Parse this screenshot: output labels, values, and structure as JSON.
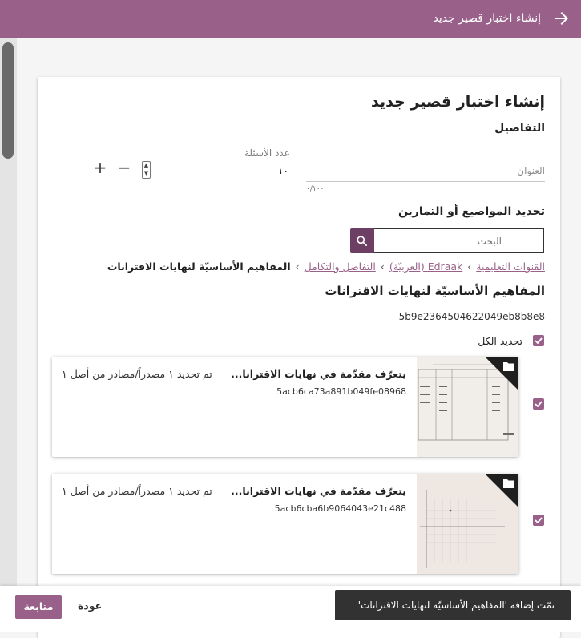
{
  "appbar": {
    "title": "إنشاء اختبار قصير جديد",
    "back_icon": "arrow-right-icon",
    "color": "#996189"
  },
  "form": {
    "heading": "إنشاء اختبار قصير جديد",
    "details_heading": "التفاصيل",
    "title_field": {
      "placeholder": "العنوان",
      "value": "",
      "counter": "٠/١٠٠"
    },
    "question_count": {
      "label": "عدد الأسئلة",
      "value": "١٠"
    },
    "select_heading": "تحديد المواضيع أو التمارين",
    "search": {
      "placeholder": "البحث"
    }
  },
  "breadcrumb": {
    "items": [
      "القنوات التعليمية",
      "Edraak (العربيّة)",
      "التفاضل والتكامل"
    ],
    "current": "المفاهيم الأساسيّة لنهايات الاقترانات"
  },
  "topic": {
    "title": "المفاهيم الأساسيّة لنهايات الاقترانات",
    "id": "5b9e2364504622049eb8b8e8",
    "select_all_label": "تحديد الكل"
  },
  "items": [
    {
      "title": "يتعرّف مقدّمة في نهايات الاقترانا...",
      "id": "5acb6ca73a891b049fe08968",
      "selected_text": "تم تحديد ١ مصدراً/مصادر من أصل ١",
      "checked": true,
      "thumb_caption": "عن ٣٠ متقدماً للاقتراب من العدد (١) من خلال النقاط"
    },
    {
      "title": "يتعرّف مقدّمة في نهايات الاقترانا...",
      "id": "5acb6cba6b9064043e21c488",
      "selected_text": "تم تحديد ١ مصدراً/مصادر من أصل ١",
      "checked": true,
      "thumb_caption": "العنوان (ق(س)) جد"
    }
  ],
  "footer": {
    "continue_label": "متابعة",
    "back_label": "عودة",
    "snackbar": "تمّت إضافة 'المفاهيم الأساسيّة لنهايات الاقترانات'"
  }
}
